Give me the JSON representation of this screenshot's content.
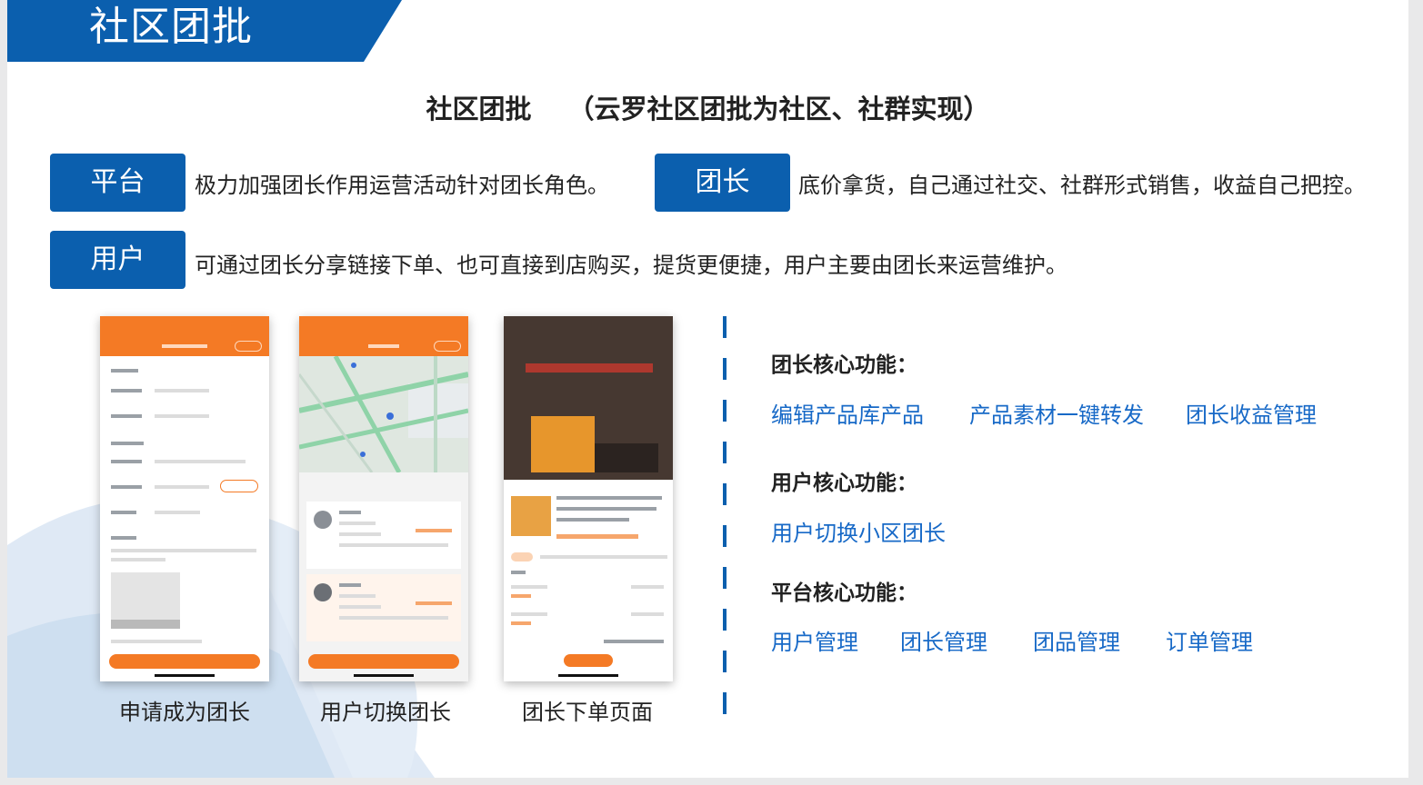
{
  "header": {
    "title": "社区团批"
  },
  "subtitle": {
    "main": "社区团批",
    "detail": "（云罗社区团批为社区、社群实现）"
  },
  "roles": [
    {
      "tag": "平台",
      "desc": "极力加强团长作用运营活动针对团长角色。"
    },
    {
      "tag": "团长",
      "desc": "底价拿货，自己通过社交、社群形式销售，收益自己把控。"
    },
    {
      "tag": "用户",
      "desc": "可通过团长分享链接下单、也可直接到店购买，提货更便捷，用户主要由团长来运营维护。"
    }
  ],
  "screens": [
    {
      "caption": "申请成为团长"
    },
    {
      "caption": "用户切换团长"
    },
    {
      "caption": "团长下单页面"
    }
  ],
  "features": {
    "leader": {
      "title": "团长核心功能：",
      "items": [
        "编辑产品库产品",
        "产品素材一键转发",
        "团长收益管理"
      ]
    },
    "user": {
      "title": "用户核心功能：",
      "items": [
        "用户切换小区团长"
      ]
    },
    "platform": {
      "title": "平台核心功能：",
      "items": [
        "用户管理",
        "团长管理",
        "团品管理",
        "订单管理"
      ]
    }
  },
  "colors": {
    "brand_blue": "#0b5fae",
    "link_blue": "#1769c7",
    "app_orange": "#f47a25",
    "decor_light": "#dbe7f4"
  }
}
